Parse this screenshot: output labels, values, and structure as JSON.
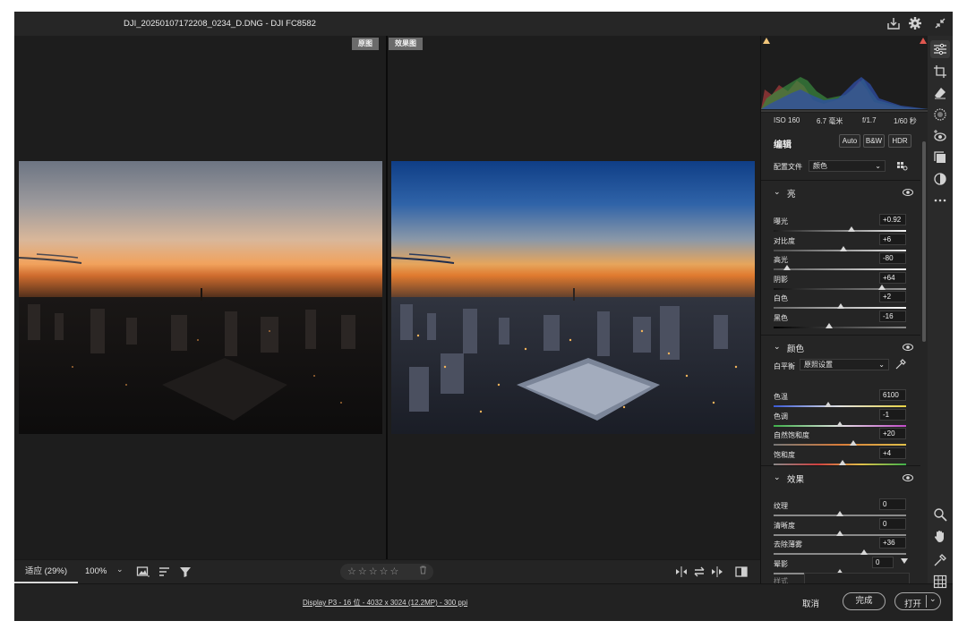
{
  "window": {
    "title": "DJI_20250107172208_0234_D.DNG -  DJI FC8582"
  },
  "compare": {
    "before_label": "原图",
    "after_label": "效果图"
  },
  "canvas_toolbar": {
    "zoom_fit": "适应 (29%)",
    "zoom_100": "100%",
    "zoom_chevron": "⌄",
    "rating": "☆☆☆☆☆",
    "trash_icon": "trash-icon"
  },
  "footer": {
    "info": "Display P3 - 16 位 - 4032 x 3024 (12.2MP) - 300 ppi",
    "cancel": "取消",
    "done": "完成",
    "open": "打开",
    "open_chevron": "⌄"
  },
  "exif": {
    "iso": "ISO 160",
    "focal": "6.7 毫米",
    "aperture": "f/1.7",
    "shutter": "1/60 秒"
  },
  "edit": {
    "title": "编辑",
    "auto": "Auto",
    "bw": "B&W",
    "hdr": "HDR",
    "profile_label": "配置文件",
    "profile_value": "颜色"
  },
  "light": {
    "title": "亮",
    "sliders": [
      {
        "label": "曝光",
        "value": "+0.92",
        "pos": 0.59
      },
      {
        "label": "对比度",
        "value": "+6",
        "pos": 0.53
      },
      {
        "label": "高光",
        "value": "-80",
        "pos": 0.1
      },
      {
        "label": "阴影",
        "value": "+64",
        "pos": 0.82
      },
      {
        "label": "白色",
        "value": "+2",
        "pos": 0.51
      },
      {
        "label": "黑色",
        "value": "-16",
        "pos": 0.42
      }
    ]
  },
  "color": {
    "title": "颜色",
    "wb_label": "白平衡",
    "wb_value": "原照设置",
    "sliders": [
      {
        "label": "色温",
        "value": "6100",
        "pos": 0.41
      },
      {
        "label": "色调",
        "value": "-1",
        "pos": 0.5
      },
      {
        "label": "自然饱和度",
        "value": "+20",
        "pos": 0.6
      },
      {
        "label": "饱和度",
        "value": "+4",
        "pos": 0.52
      }
    ]
  },
  "effects": {
    "title": "效果",
    "sliders": [
      {
        "label": "纹理",
        "value": "0",
        "pos": 0.5
      },
      {
        "label": "清晰度",
        "value": "0",
        "pos": 0.5
      },
      {
        "label": "去除薄雾",
        "value": "+36",
        "pos": 0.68
      },
      {
        "label": "晕影",
        "value": "0",
        "pos": 0.5
      }
    ],
    "style_label": "样式"
  },
  "colors": {
    "accent": "#d8d8d8",
    "panel_bg": "#252525",
    "canvas_bg": "#1d1d1d"
  }
}
